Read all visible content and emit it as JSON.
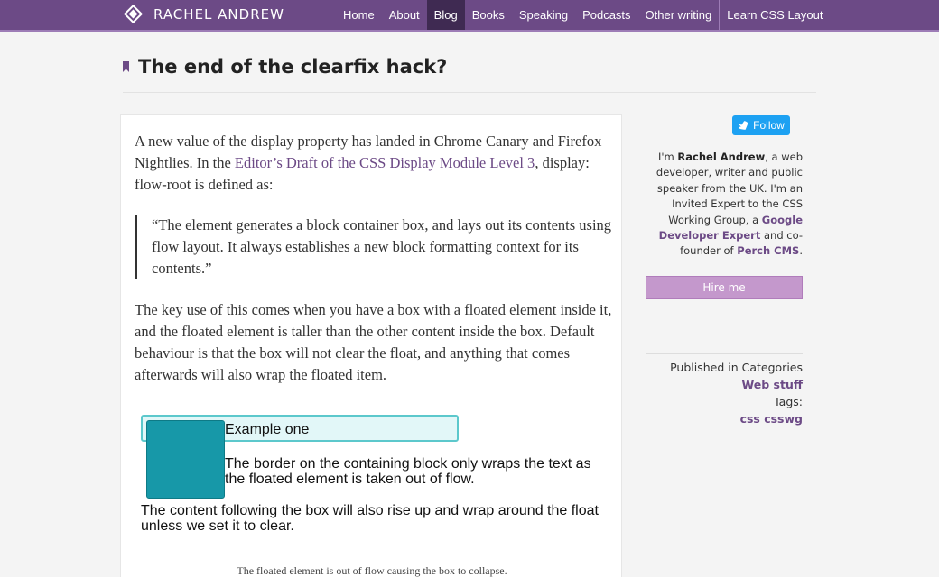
{
  "header": {
    "brand": "RACHEL ANDREW",
    "nav": [
      "Home",
      "About",
      "Blog",
      "Books",
      "Speaking",
      "Podcasts",
      "Other writing"
    ],
    "nav_extra": "Learn CSS Layout",
    "active": "Blog"
  },
  "post": {
    "title": "The end of the clearfix hack?",
    "p1_before": "A new value of the display property has landed in Chrome Canary and Firefox Nightlies. In the ",
    "p1_link": "Editor’s Draft of the CSS Display Module Level 3",
    "p1_after": ", display: flow-root is defined as:",
    "quote": "“The element generates a block container box, and lays out its contents using flow layout. It always establishes a new block formatting context for its contents.”",
    "p2": "The key use of this comes when you have a box with a floated element inside it, and the floated element is taller than the other content inside the box. Default behaviour is that the box will not clear the float, and anything that comes afterwards will also wrap the floated item.",
    "example": {
      "label": "Example one",
      "text1": "The border on the containing block only wraps the text as the floated element is taken out of flow.",
      "text2": "The content following the box will also rise up and wrap around the float unless we set it to clear."
    },
    "caption": "The floated element is out of flow causing the box to collapse."
  },
  "sidebar": {
    "follow": "Follow",
    "bio": {
      "t1": "I'm ",
      "name": "Rachel Andrew",
      "t2": ", a web developer, writer and public speaker from the UK. I'm an Invited Expert to the CSS Working Group, a ",
      "gde": "Google Developer Expert",
      "t3": " and co-founder of ",
      "perch": "Perch CMS",
      "t4": "."
    },
    "hire": "Hire me",
    "published_in": "Published in Categories",
    "category": "Web stuff",
    "tags_label": "Tags:",
    "tags": "css csswg"
  },
  "colors": {
    "brand": "#6c4a86",
    "accent": "#c498cc",
    "twitter": "#1da1f2",
    "example_float": "#1798a8"
  }
}
